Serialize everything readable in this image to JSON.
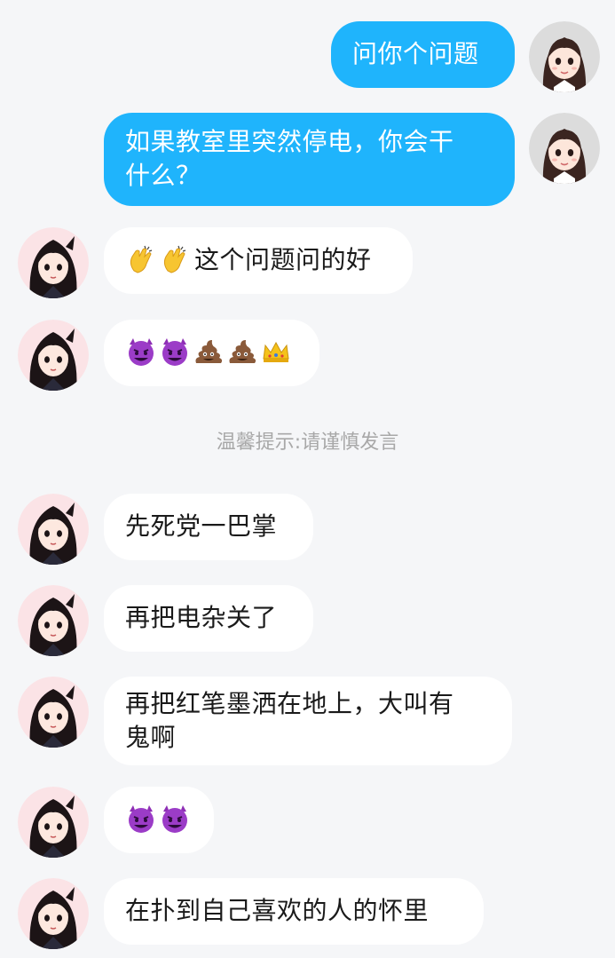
{
  "messages": [
    {
      "side": "out",
      "text": "问你个问题"
    },
    {
      "side": "out",
      "text": "如果教室里突然停电，你会干什么？",
      "line1": "如果教室里突然停电，你会干",
      "line2": "什么？"
    },
    {
      "side": "in",
      "emojis": [
        "clapping-hands-emoji",
        "clapping-hands-emoji"
      ],
      "text": "这个问题问的好"
    },
    {
      "side": "in",
      "emojis": [
        "smiling-devil-emoji",
        "smiling-devil-emoji",
        "poop-emoji",
        "poop-emoji",
        "crown-emoji"
      ]
    },
    {
      "side": "in",
      "text": "先死党一巴掌"
    },
    {
      "side": "in",
      "text": "再把电杂关了"
    },
    {
      "side": "in",
      "text": "再把红笔墨洒在地上，大叫有鬼啊",
      "line1": "再把红笔墨洒在地上，大叫有",
      "line2": "鬼啊"
    },
    {
      "side": "in",
      "emojis": [
        "smiling-devil-emoji",
        "smiling-devil-emoji"
      ]
    },
    {
      "side": "in",
      "text": "在扑到自己喜欢的人的怀里"
    }
  ],
  "system_tip": "温馨提示:请谨慎发言",
  "colors": {
    "background": "#f5f6f8",
    "outgoing_bubble": "#1fb4fc",
    "incoming_bubble": "#ffffff",
    "tip_text": "#a8a8a8"
  }
}
